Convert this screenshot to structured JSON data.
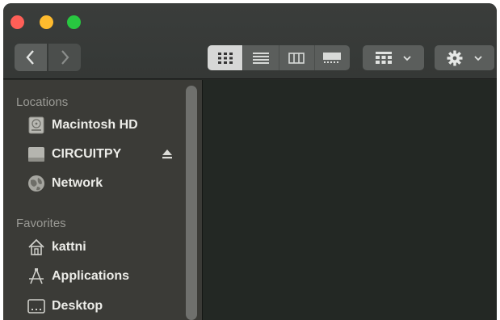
{
  "window": {
    "traffic_lights": {
      "close": "#fe5f57",
      "minimize": "#febb2e",
      "maximize": "#28c840"
    }
  },
  "toolbar": {
    "back_icon": "chevron-left-icon",
    "forward_icon": "chevron-right-icon",
    "view_modes": [
      "icon-view",
      "list-view",
      "column-view",
      "gallery-view"
    ],
    "selected_view": "icon-view",
    "group_icon": "grid-group-icon",
    "action_icon": "gear-icon"
  },
  "sidebar": {
    "locations_title": "Locations",
    "locations": [
      {
        "label": "Macintosh HD",
        "icon": "hard-drive-icon"
      },
      {
        "label": "CIRCUITPY",
        "icon": "external-drive-icon",
        "ejectable": true
      },
      {
        "label": "Network",
        "icon": "network-globe-icon"
      }
    ],
    "favorites_title": "Favorites",
    "favorites": [
      {
        "label": "kattni",
        "icon": "home-icon"
      },
      {
        "label": "Applications",
        "icon": "applications-icon"
      },
      {
        "label": "Desktop",
        "icon": "desktop-icon"
      }
    ]
  }
}
